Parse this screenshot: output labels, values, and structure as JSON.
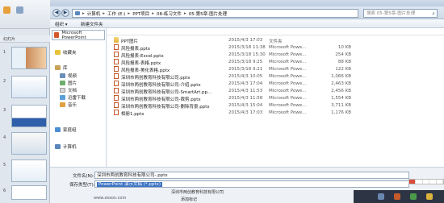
{
  "dialog": {
    "title": "另存为",
    "address": {
      "crumbs": [
        "计算机",
        "工作 (E:)",
        "PPT项目",
        "08-练习文件",
        "05-第5章-图片处理"
      ]
    },
    "search_placeholder": "搜索 05-第5章-图片处理",
    "toolbar": {
      "organize": "组织 ▾",
      "new_folder": "新建文件夹"
    },
    "nav": {
      "top_item": "Microsoft PowerPoint",
      "favorites": "收藏夹",
      "library": "库",
      "video": "视频",
      "pictures": "图片",
      "documents": "文档",
      "thunder": "迅雷下载",
      "music": "音乐",
      "homegroup": "家庭组",
      "computer": "计算机"
    },
    "files": [
      {
        "name": "PPT图片",
        "date": "2015/4/3 17:03",
        "type": "文件夹",
        "size": "",
        "icon": "folder"
      },
      {
        "name": "风险报表.pptx",
        "date": "2015/3/18 11:38",
        "type": "Microsoft Powe...",
        "size": "10 KB",
        "icon": "ppt"
      },
      {
        "name": "风险报表-Excel.pptx",
        "date": "2015/3/18 15:30",
        "type": "Microsoft Powe...",
        "size": "254 KB",
        "icon": "ppt"
      },
      {
        "name": "风险报表-表格.pptx",
        "date": "2015/3/18 9:25",
        "type": "Microsoft Powe...",
        "size": "88 KB",
        "icon": "ppt"
      },
      {
        "name": "风险报表-美化表格.pptx",
        "date": "2015/3/18 9:21",
        "type": "Microsoft Powe...",
        "size": "122 KB",
        "icon": "ppt"
      },
      {
        "name": "深圳市两创教育科技有限公司.pptx",
        "date": "2015/4/3 10:05",
        "type": "Microsoft Powe...",
        "size": "1,066 KB",
        "icon": "ppt"
      },
      {
        "name": "深圳市两创教育科技有限公司-介绍.pptx",
        "date": "2015/4/3 17:04",
        "type": "Microsoft Powe...",
        "size": "2,463 KB",
        "icon": "ppt"
      },
      {
        "name": "深圳市两创教育科技有限公司-SmartArt.pp...",
        "date": "2015/4/3 11:53",
        "type": "Microsoft Powe...",
        "size": "2,456 KB",
        "icon": "ppt"
      },
      {
        "name": "深圳市两创教育科技有限公司-裁剪.pptx",
        "date": "2015/4/3 11:58",
        "type": "Microsoft Powe...",
        "size": "1,554 KB",
        "icon": "ppt"
      },
      {
        "name": "深圳市两创教育科技有限公司-删除背景.pptx",
        "date": "2015/4/3 15:04",
        "type": "Microsoft Powe...",
        "size": "3,711 KB",
        "icon": "ppt"
      },
      {
        "name": "相册1.pptx",
        "date": "2015/4/3 17:03",
        "type": "Microsoft Powe...",
        "size": "1,176 KB",
        "icon": "ppt"
      }
    ],
    "filename_label": "文件名(N):",
    "filename_value": "深圳市两创教育科技有限公司-.pptx",
    "filetype_label": "保存类型(T):",
    "filetype_value": "PowerPoint 演示文稿 (*.pptx)",
    "author_value": "深圳市两创教育科技有限公司",
    "tags_label": "添加标记",
    "website": "www.zexon.com"
  },
  "ppt": {
    "tab_outline": "幻灯片",
    "slide_numbers": [
      "1",
      "2",
      "3",
      "4",
      "5",
      "6"
    ]
  },
  "colors": {
    "accent": "#3b73c4",
    "ppt_orange": "#d2572a",
    "folder_yellow": "#e2b23d"
  }
}
